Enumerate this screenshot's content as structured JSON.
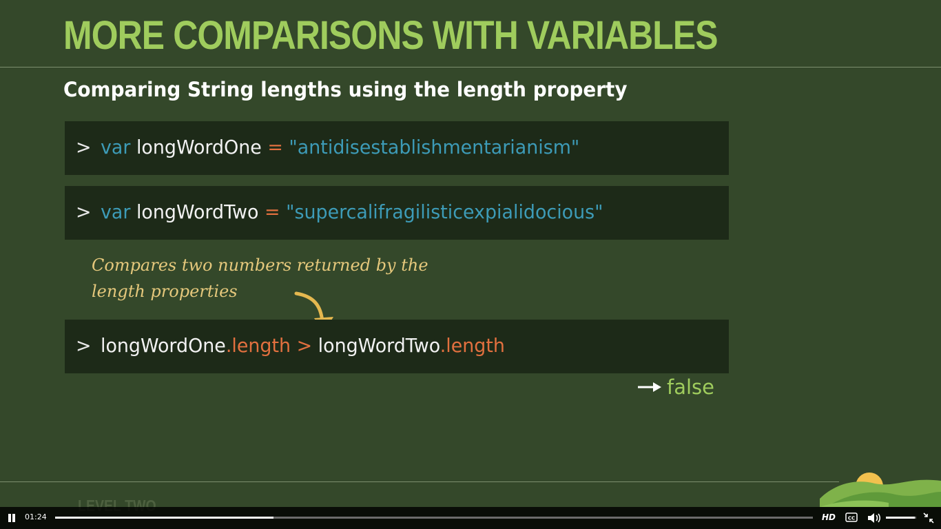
{
  "slide": {
    "title": "MORE COMPARISONS WITH VARIABLES",
    "subtitle": "Comparing String lengths using the length property",
    "code": [
      {
        "prompt": ">",
        "keyword": "var",
        "name": "longWordOne",
        "operator": "=",
        "value": "\"antidisestablishmentarianism\""
      },
      {
        "prompt": ">",
        "keyword": "var",
        "name": "longWordTwo",
        "operator": "=",
        "value": "\"supercalifragilisticexpialidocious\""
      }
    ],
    "annotation": {
      "line1": "Compares two numbers returned by the",
      "line2": "length properties"
    },
    "comparison": {
      "prompt": ">",
      "left_object": "longWordOne",
      "left_property": ".length",
      "operator": ">",
      "right_object": "longWordTwo",
      "right_property": ".length"
    },
    "result": "false",
    "level": "LEVEL TWO"
  },
  "player": {
    "current_time": "01:24",
    "progress": 0.288,
    "volume": 0.95,
    "hd_label": "HD",
    "icons": [
      "pause-icon",
      "closed-captions-icon",
      "volume-icon",
      "exit-fullscreen-icon"
    ]
  },
  "colors": {
    "background": "#34482a",
    "title": "#9fcc5d",
    "code_bg": "#1d2a18",
    "keyword": "#3d9bb7",
    "operator": "#e2703f",
    "annotation": "#e5c87c"
  }
}
